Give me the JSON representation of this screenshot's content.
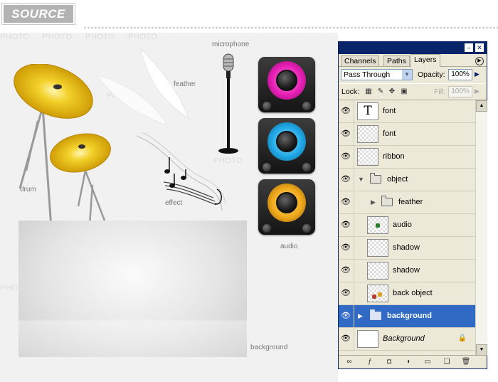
{
  "header": {
    "badge": "SOURCE"
  },
  "canvas": {
    "watermark": "PHOTO",
    "labels": {
      "drum": "drum",
      "feather": "feather",
      "microphone": "microphone",
      "effect": "effect",
      "audio": "audio",
      "background": "background"
    },
    "speaker_colors": [
      "#e61eb4",
      "#20a8e6",
      "#f0a81a"
    ]
  },
  "panel": {
    "tabs": [
      "Channels",
      "Paths",
      "Layers"
    ],
    "active_tab": "Layers",
    "blend_mode": "Pass Through",
    "opacity_label": "Opacity:",
    "opacity_value": "100%",
    "lock_label": "Lock:",
    "fill_label": "Fill:",
    "fill_value": "100%",
    "layers": [
      {
        "name": "font",
        "kind": "text"
      },
      {
        "name": "font",
        "kind": "layer"
      },
      {
        "name": "ribbon",
        "kind": "layer"
      },
      {
        "name": "object",
        "kind": "group-open"
      },
      {
        "name": "feather",
        "kind": "group-closed"
      },
      {
        "name": "audio",
        "kind": "layer"
      },
      {
        "name": "shadow",
        "kind": "layer"
      },
      {
        "name": "shadow",
        "kind": "layer"
      },
      {
        "name": "back object",
        "kind": "layer"
      },
      {
        "name": "background",
        "kind": "group-selected"
      },
      {
        "name": "Background",
        "kind": "background"
      }
    ],
    "selection_color": "#316ac5"
  }
}
